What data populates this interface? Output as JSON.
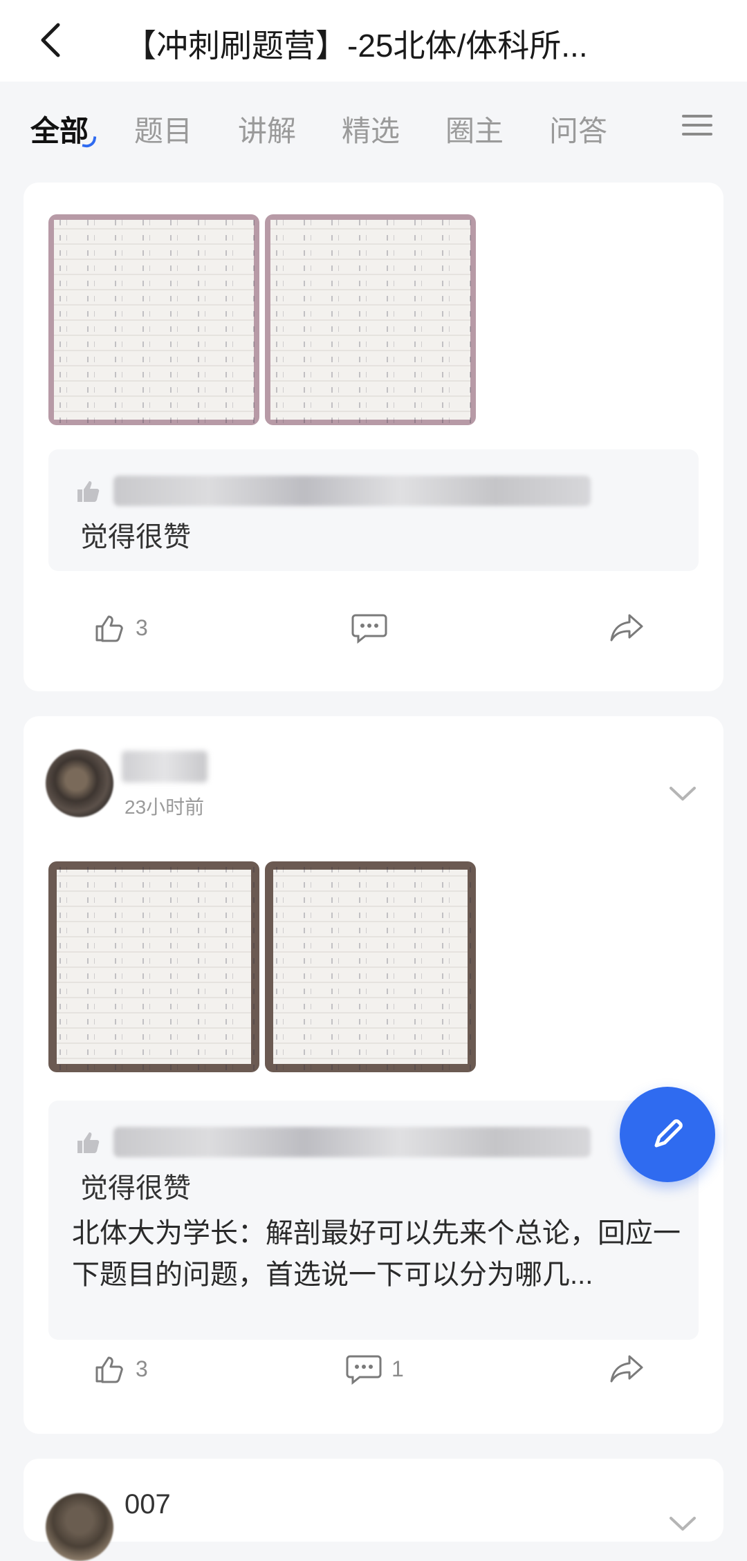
{
  "header": {
    "title": "【冲刺刷题营】-25北体/体科所..."
  },
  "tabs": [
    {
      "label": "全部",
      "active": true
    },
    {
      "label": "题目",
      "active": false
    },
    {
      "label": "讲解",
      "active": false
    },
    {
      "label": "精选",
      "active": false
    },
    {
      "label": "圈主",
      "active": false
    },
    {
      "label": "问答",
      "active": false
    }
  ],
  "posts": [
    {
      "likes_summary_suffix": "觉得很赞",
      "like_count": "3",
      "comment_count": "",
      "images": [
        "handwritten-notes-1",
        "handwritten-notes-2"
      ]
    },
    {
      "time": "23小时前",
      "likes_summary_suffix": "觉得很赞",
      "comment_author": "北体大为学长：",
      "comment_text": "解剖最好可以先来个总论，回应一下题目的问题，首选说一下可以分为哪几...",
      "like_count": "3",
      "comment_count": "1",
      "images": [
        "handwritten-notes-3",
        "handwritten-notes-4"
      ]
    },
    {
      "author": "007"
    }
  ],
  "colors": {
    "accent": "#2f6bf0",
    "background": "#f5f6f8",
    "card": "#ffffff"
  }
}
